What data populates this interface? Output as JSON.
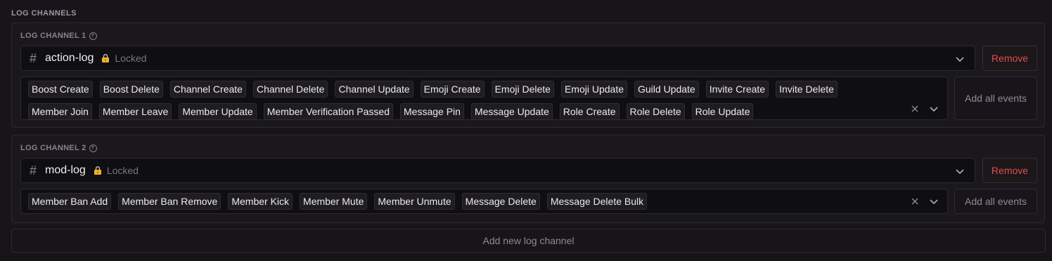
{
  "section_title": "LOG CHANNELS",
  "channels": [
    {
      "label": "LOG CHANNEL 1",
      "channel_name": "action-log",
      "status": "Locked",
      "remove_label": "Remove",
      "add_all_label": "Add all events",
      "events": [
        "Boost Create",
        "Boost Delete",
        "Channel Create",
        "Channel Delete",
        "Channel Update",
        "Emoji Create",
        "Emoji Delete",
        "Emoji Update",
        "Guild Update",
        "Invite Create",
        "Invite Delete",
        "Member Join",
        "Member Leave",
        "Member Update",
        "Member Verification Passed",
        "Message Pin",
        "Message Update",
        "Role Create",
        "Role Delete",
        "Role Update"
      ]
    },
    {
      "label": "LOG CHANNEL 2",
      "channel_name": "mod-log",
      "status": "Locked",
      "remove_label": "Remove",
      "add_all_label": "Add all events",
      "events": [
        "Member Ban Add",
        "Member Ban Remove",
        "Member Kick",
        "Member Mute",
        "Member Unmute",
        "Message Delete",
        "Message Delete Bulk"
      ]
    }
  ],
  "add_new_label": "Add new log channel",
  "icons": {
    "hash": "#",
    "help": "?",
    "lock": "lock-icon",
    "chevron": "chevron-down-icon",
    "clear": "close-icon"
  },
  "colors": {
    "background": "#17151a",
    "remove": "#d9534f",
    "lock": "#f0b429"
  }
}
